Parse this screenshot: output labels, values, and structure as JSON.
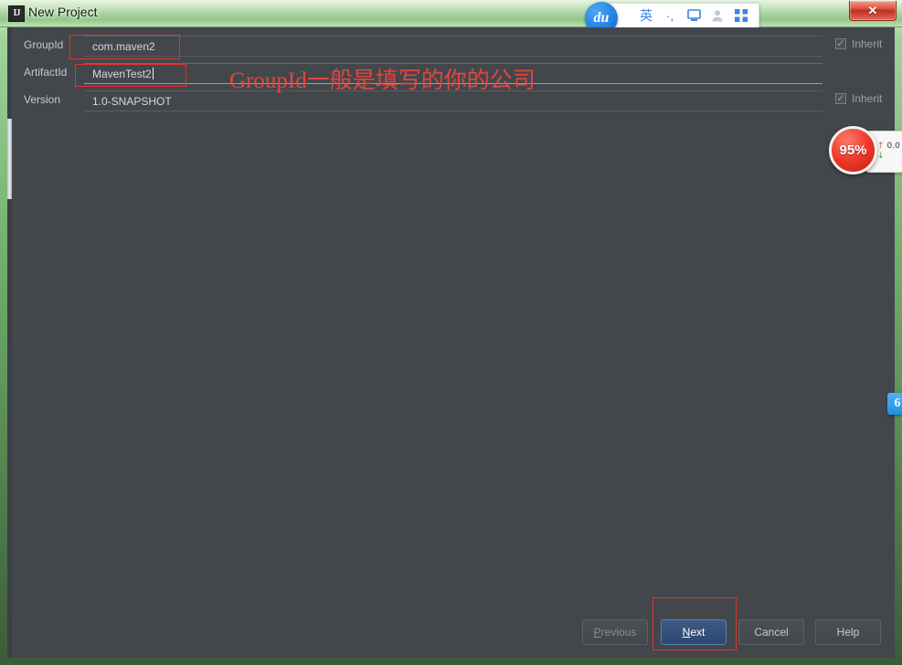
{
  "window": {
    "title": "New Project",
    "app_icon_glyph": "IJ",
    "close_glyph": "✕"
  },
  "ime": {
    "logo_text": "du",
    "items": [
      {
        "name": "language-mode",
        "glyph": "英"
      },
      {
        "name": "punctuation-mode",
        "glyph": "·,"
      },
      {
        "name": "soft-keyboard",
        "glyph": "⎕"
      },
      {
        "name": "user-account",
        "glyph": "●"
      },
      {
        "name": "toolbox",
        "glyph": "☷"
      }
    ]
  },
  "form": {
    "rows": [
      {
        "label": "GroupId",
        "value": "com.maven2",
        "focused": false,
        "caret": false,
        "inherit": {
          "shown": true,
          "label": "Inherit",
          "checked": true,
          "check_glyph": "✓"
        },
        "annotated": true
      },
      {
        "label": "ArtifactId",
        "value": "MavenTest2",
        "focused": true,
        "caret": true,
        "inherit": {
          "shown": false,
          "label": "Inherit",
          "checked": false,
          "check_glyph": "✓"
        },
        "annotated": true
      },
      {
        "label": "Version",
        "value": "1.0-SNAPSHOT",
        "focused": false,
        "caret": false,
        "inherit": {
          "shown": true,
          "label": "Inherit",
          "checked": true,
          "check_glyph": "✓"
        },
        "annotated": false
      }
    ]
  },
  "annotation": {
    "text": "GroupId一般是填写的你的公司",
    "color": "#f0453d"
  },
  "buttons": {
    "previous": {
      "label": "Previous",
      "mnemonic": "P",
      "rest": "revious",
      "disabled": true
    },
    "next": {
      "label": "Next",
      "mnemonic": "N",
      "rest": "ext",
      "default": true
    },
    "cancel": {
      "label": "Cancel",
      "disabled": false
    },
    "help": {
      "label": "Help",
      "disabled": false
    }
  },
  "speed_widget": {
    "percent": "95%",
    "upload": "0.0",
    "download": "",
    "up_glyph": "↑",
    "down_glyph": "↓"
  },
  "dock": {
    "glyph": "6"
  },
  "colors": {
    "dialog_background": "#43474c",
    "title_bar": "#a9d4a0",
    "annotation_red": "#e8302a",
    "default_button": "#2e4871",
    "focus_underline": "#7ba7cf"
  }
}
